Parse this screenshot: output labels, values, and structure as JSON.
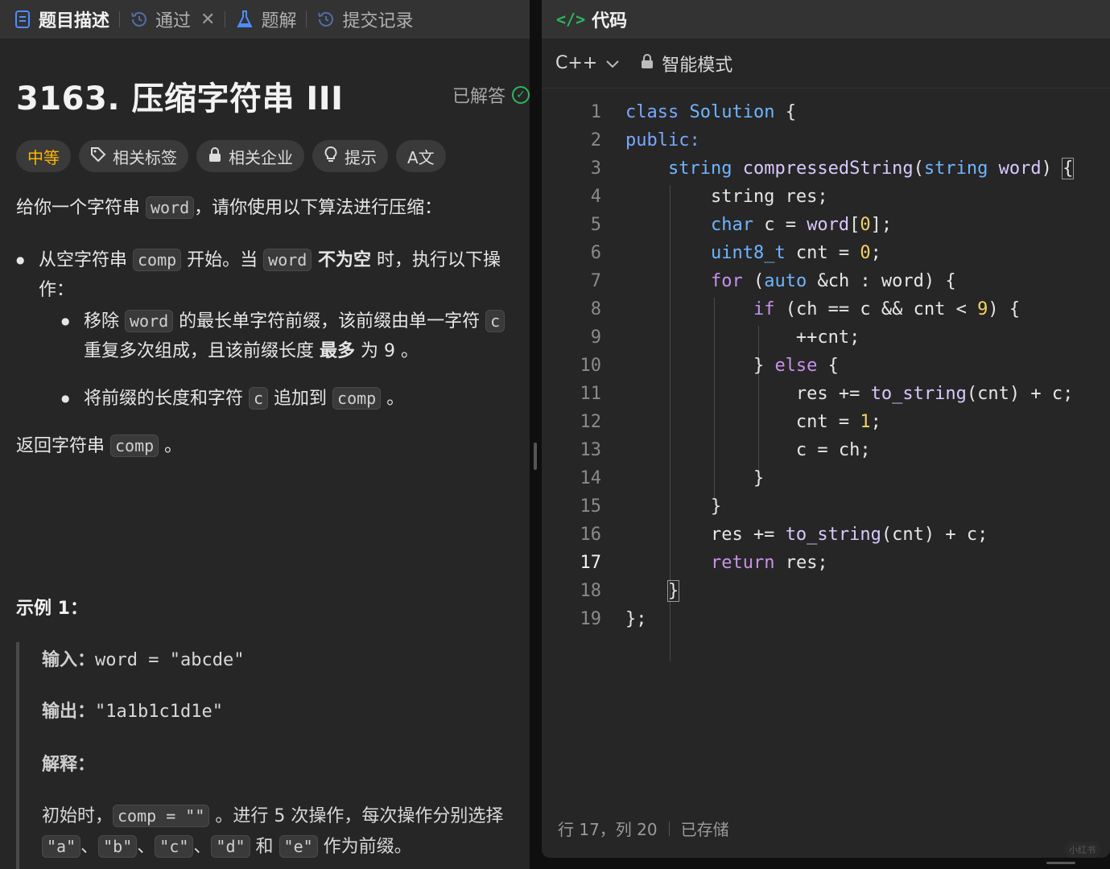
{
  "left_tabs": [
    {
      "label": "题目描述",
      "icon": "document-icon"
    },
    {
      "label": "通过",
      "icon": "history-icon"
    },
    {
      "label": "题解",
      "icon": "flask-icon"
    },
    {
      "label": "提交记录",
      "icon": "history-icon"
    }
  ],
  "problem": {
    "title": "3163. 压缩字符串 III",
    "status": "已解答",
    "difficulty": "中等",
    "chips": [
      "相关标签",
      "相关企业",
      "提示",
      "A文"
    ]
  },
  "description": {
    "p1_a": "给你一个字符串 ",
    "p1_code": "word",
    "p1_b": "，请你使用以下算法进行压缩：",
    "b1_a": "从空字符串 ",
    "b1_code1": "comp",
    "b1_b": " 开始。当 ",
    "b1_code2": "word",
    "b1_bold": " 不为空",
    "b1_c": " 时，执行以下操作：",
    "s1_a": "移除 ",
    "s1_code": "word",
    "s1_b": " 的最长单字符前缀，该前缀由单一字符 ",
    "s1_code2": "c",
    "s1_c": " 重复多次组成，且该前缀长度 ",
    "s1_bold": "最多",
    "s1_d": " 为 9 。",
    "s2_a": "将前缀的长度和字符 ",
    "s2_code": "c",
    "s2_b": " 追加到 ",
    "s2_code2": "comp",
    "s2_c": " 。",
    "ret_a": "返回字符串 ",
    "ret_code": "comp",
    "ret_b": " 。"
  },
  "example": {
    "title": "示例 1：",
    "input_label": "输入：",
    "input_value": "word = \"abcde\"",
    "output_label": "输出：",
    "output_value": "\"1a1b1c1d1e\"",
    "explain_label": "解释：",
    "explain_a": "初始时，",
    "explain_code": "comp = \"\"",
    "explain_b": " 。进行 5 次操作，每次操作分别选择",
    "chars": [
      "\"a\"",
      "\"b\"",
      "\"c\"",
      "\"d\"",
      "\"e\""
    ],
    "sep1": "、",
    "and_text": " 和 ",
    "explain_c": " 作为前缀。"
  },
  "code_panel": {
    "title": "代码",
    "language": "C++",
    "mode": "智能模式",
    "current_line": 17,
    "line_numbers": [
      "1",
      "2",
      "3",
      "4",
      "5",
      "6",
      "7",
      "8",
      "9",
      "10",
      "11",
      "12",
      "13",
      "14",
      "15",
      "16",
      "17",
      "18",
      "19"
    ],
    "status_position": "行 17，列 20",
    "status_saved": "已存储"
  },
  "watermark": "小红书",
  "colors": {
    "accent_green": "#2db55d",
    "difficulty_medium": "#ffb800",
    "keyword_purple": "#c792ea",
    "keyword_blue": "#7aa7ff",
    "number_yellow": "#f4d266"
  }
}
